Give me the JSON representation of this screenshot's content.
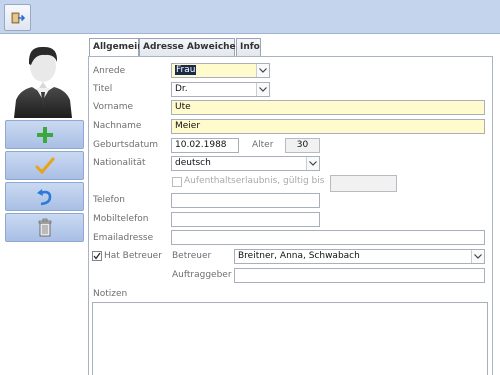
{
  "tabs": [
    "Allgemein",
    "Adresse Abweichend",
    "Info"
  ],
  "icons": {
    "top_button": "exit-door-icon",
    "add": "plus-icon",
    "save": "checkmark-icon",
    "undo": "undo-arrow-icon",
    "delete": "trash-can-icon",
    "avatar": "person-avatar-icon"
  },
  "colors": {
    "toolbar_bg": "#c4d4ec",
    "required_field": "#fffbcc",
    "button_bg": "#b9cceb"
  },
  "form": {
    "anrede": {
      "label": "Anrede",
      "value": "Frau"
    },
    "titel": {
      "label": "Titel",
      "value": "Dr."
    },
    "vorname": {
      "label": "Vorname",
      "value": "Ute"
    },
    "nachname": {
      "label": "Nachname",
      "value": "Meier"
    },
    "geburtsdatum": {
      "label": "Geburtsdatum",
      "value": "10.02.1988"
    },
    "alter": {
      "label": "Alter",
      "value": "30"
    },
    "nationalitaet": {
      "label": "Nationalität",
      "value": "deutsch"
    },
    "aufenthalt": {
      "label": "Aufenthaltserlaubnis, gültig bis",
      "checked": false,
      "value": ""
    },
    "telefon": {
      "label": "Telefon",
      "value": ""
    },
    "mobiltelefon": {
      "label": "Mobiltelefon",
      "value": ""
    },
    "email": {
      "label": "Emailadresse",
      "value": ""
    },
    "hat_betreuer": {
      "label": "Hat Betreuer",
      "checked": true
    },
    "betreuer": {
      "label": "Betreuer",
      "value": "Breitner, Anna, Schwabach"
    },
    "auftraggeber": {
      "label": "Auftraggeber",
      "value": ""
    },
    "notizen": {
      "label": "Notizen",
      "value": ""
    }
  }
}
